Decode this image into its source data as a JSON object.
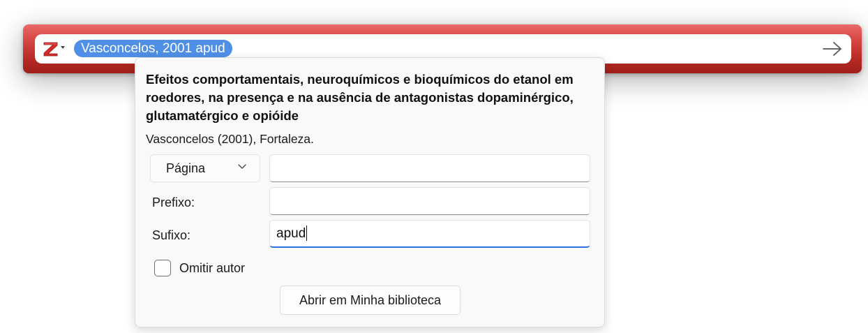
{
  "citation_bar": {
    "menu_icon": "zotero-z-icon",
    "citation_bubble": "Vasconcelos, 2001 apud",
    "accept_icon": "arrow-right-icon",
    "bar_color": "#c0302b",
    "bubble_color": "#4f8fe6"
  },
  "item": {
    "title": "Efeitos comportamentais, neuroquímicos e bioquímicos do etanol em roedores, na presença e na ausência de antagonistas dopaminérgico, glutamatérgico e opióide",
    "description": "Vasconcelos (2001), Fortaleza."
  },
  "form": {
    "locator_type": "Página",
    "locator_value": "",
    "prefix_label": "Prefixo:",
    "prefix_value": "",
    "suffix_label": "Sufixo:",
    "suffix_value": "apud",
    "suppress_author_label": "Omitir autor",
    "suppress_author_checked": false,
    "open_button": "Abrir em Minha biblioteca",
    "focus_color": "#2f6fdd"
  }
}
